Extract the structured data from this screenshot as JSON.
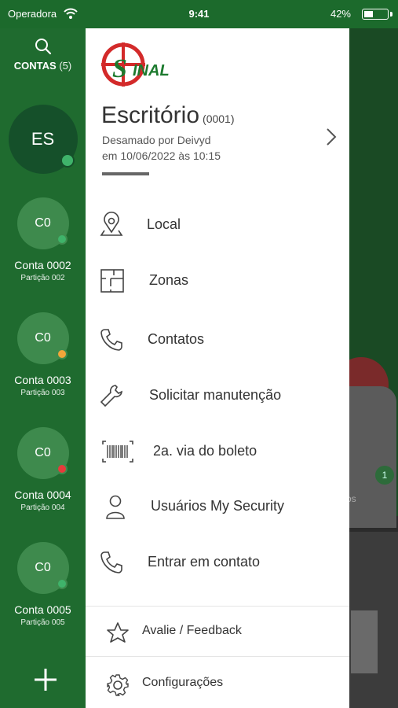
{
  "status_bar": {
    "carrier": "Operadora",
    "time": "9:41",
    "battery_pct": "42%",
    "battery_level": 0.42
  },
  "sidebar": {
    "accounts_label": "CONTAS",
    "accounts_count": "(5)",
    "current": {
      "initials": "ES",
      "status_color": "#3fb36a"
    },
    "accounts": [
      {
        "initials": "C0",
        "name": "Conta 0002",
        "partition": "Partição 002",
        "status_color": "#3fb36a"
      },
      {
        "initials": "C0",
        "name": "Conta 0003",
        "partition": "Partição 003",
        "status_color": "#f2a63a"
      },
      {
        "initials": "C0",
        "name": "Conta 0004",
        "partition": "Partição 004",
        "status_color": "#e63b3b"
      },
      {
        "initials": "C0",
        "name": "Conta 0005",
        "partition": "Partição 005",
        "status_color": "#3fb36a"
      }
    ]
  },
  "drawer": {
    "logo_text": "SINAL",
    "title": "Escritório",
    "code": "(0001)",
    "subtitle_1": "Desamado por Deivyd",
    "subtitle_2": "em  10/06/2022 às 10:15",
    "menu": [
      {
        "label": "Local",
        "icon": "map-pin-icon"
      },
      {
        "label": "Zonas",
        "icon": "floorplan-icon"
      },
      {
        "label": "Contatos",
        "icon": "phone-icon"
      },
      {
        "label": "Solicitar manutenção",
        "icon": "wrench-icon"
      },
      {
        "label": "2a. via do boleto",
        "icon": "barcode-icon"
      },
      {
        "label": "Usuários My Security",
        "icon": "user-icon"
      },
      {
        "label": "Entrar em contato",
        "icon": "phone-icon"
      }
    ],
    "footer": [
      {
        "label": "Avalie / Feedback",
        "icon": "star-icon"
      },
      {
        "label": "Configurações",
        "icon": "gear-icon"
      }
    ]
  },
  "background": {
    "badge": "1",
    "partial_label": "os"
  },
  "colors": {
    "sidebar_bg": "#1f6b2f",
    "accent": "#1f6b2f",
    "logo_red": "#d32a2a",
    "logo_green": "#1c7a2e"
  }
}
